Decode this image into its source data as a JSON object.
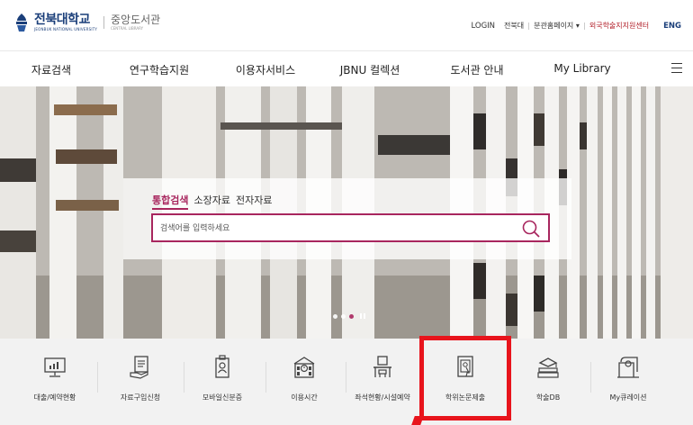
{
  "header": {
    "university_ko": "전북대학교",
    "university_en": "JEONBUK NATIONAL UNIVERSITY",
    "library_ko": "중앙도서관",
    "library_en": "CENTRAL LIBRARY",
    "util": {
      "login": "LOGIN",
      "branch1": "전북대",
      "branch2": "분관홈페이지 ▾",
      "foreign": "외국학술지지원센터",
      "eng": "ENG"
    }
  },
  "nav": {
    "items": [
      "자료검색",
      "연구학습지원",
      "이용자서비스",
      "JBNU 컬렉션",
      "도서관 안내",
      "My Library"
    ]
  },
  "search": {
    "tabs": [
      "통합검색",
      "소장자료",
      "전자자료"
    ],
    "active_tab": "통합검색",
    "placeholder": "검색어를 입력하세요"
  },
  "quick_menu": {
    "items": [
      {
        "label": "대출/예약현황",
        "icon": "monitor-chart-icon"
      },
      {
        "label": "자료구입신청",
        "icon": "document-hand-icon"
      },
      {
        "label": "모바일신분증",
        "icon": "id-badge-icon"
      },
      {
        "label": "이용시간",
        "icon": "building-clock-icon"
      },
      {
        "label": "좌석현황/시설예약",
        "icon": "desk-chair-icon"
      },
      {
        "label": "학위논문제출",
        "icon": "thesis-submit-icon"
      },
      {
        "label": "학술DB",
        "icon": "books-stack-icon"
      },
      {
        "label": "My큐레이션",
        "icon": "curation-icon"
      }
    ]
  },
  "colors": {
    "accent": "#a8265e",
    "brand": "#1b3f7a",
    "highlight": "#e8141c"
  }
}
